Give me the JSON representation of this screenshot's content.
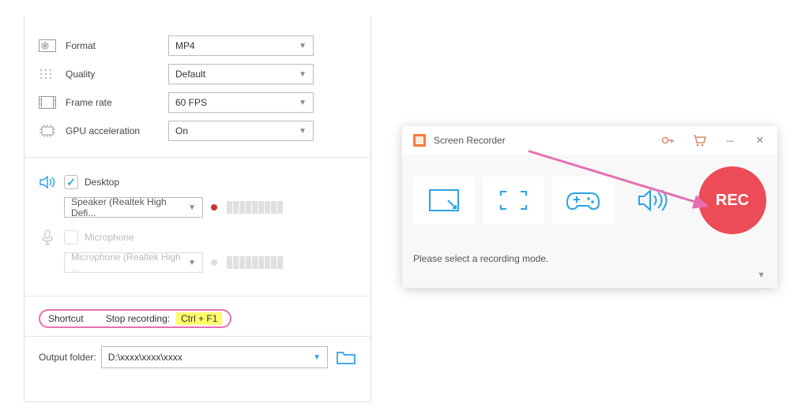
{
  "settings": {
    "format": {
      "label": "Format",
      "value": "MP4"
    },
    "quality": {
      "label": "Quality",
      "value": "Default"
    },
    "framerate": {
      "label": "Frame rate",
      "value": "60 FPS"
    },
    "gpu": {
      "label": "GPU acceleration",
      "value": "On"
    }
  },
  "audio": {
    "desktop": {
      "label": "Desktop",
      "device": "Speaker (Realtek High Defi..."
    },
    "microphone": {
      "label": "Microphone",
      "device": "Microphone (Realtek High ..."
    }
  },
  "shortcut": {
    "label": "Shortcut",
    "mid": "Stop recording:",
    "key": "Ctrl + F1"
  },
  "output": {
    "label": "Output folder:",
    "path": "D:\\xxxx\\xxxx\\xxxx"
  },
  "recorder": {
    "title": "Screen Recorder",
    "rec": "REC",
    "hint": "Please select a recording mode."
  }
}
